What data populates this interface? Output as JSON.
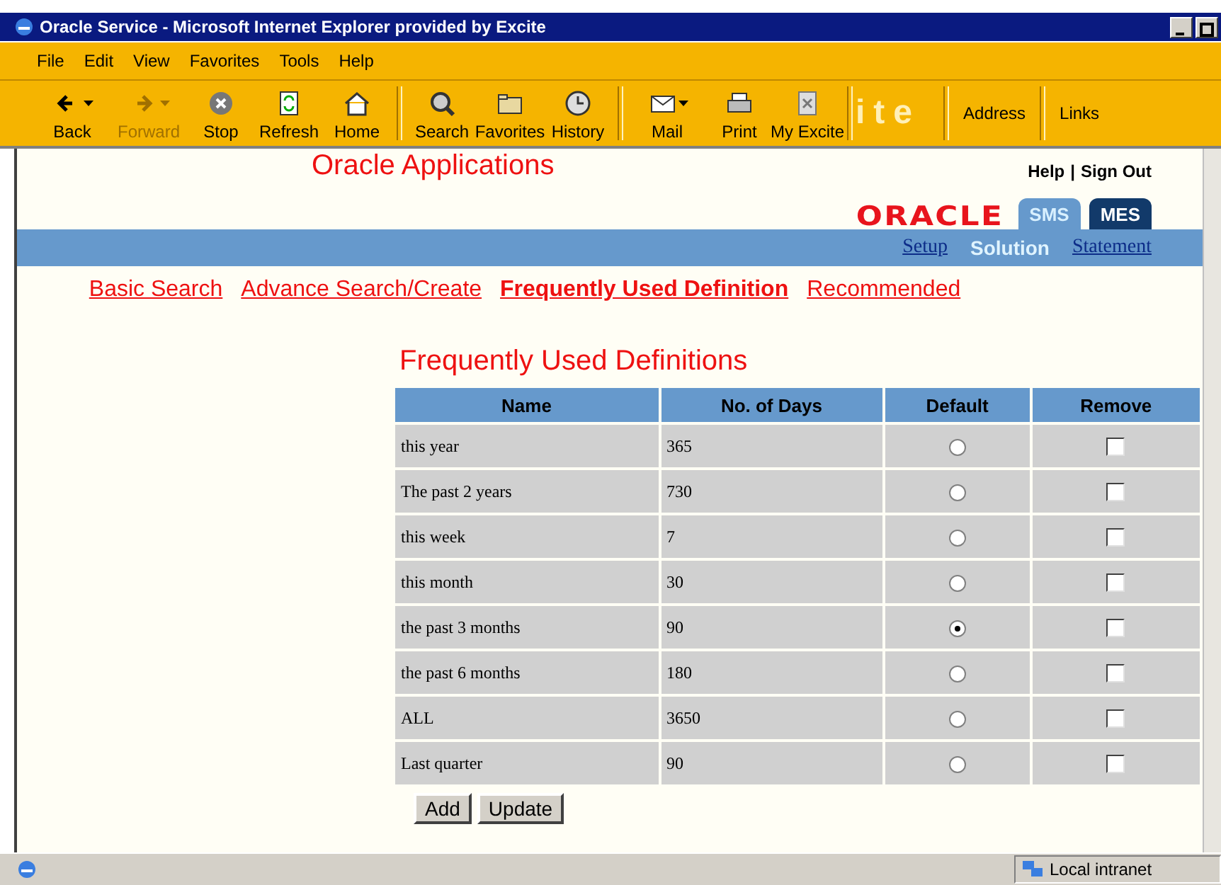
{
  "window": {
    "title": "Oracle Service - Microsoft Internet Explorer provided by Excite"
  },
  "menu": [
    "File",
    "Edit",
    "View",
    "Favorites",
    "Tools",
    "Help"
  ],
  "toolbar": [
    {
      "kind": "back",
      "label": "Back",
      "disabled": false,
      "dropdown": true
    },
    {
      "kind": "forward",
      "label": "Forward",
      "disabled": true,
      "dropdown": true
    },
    {
      "kind": "stop",
      "label": "Stop",
      "disabled": false,
      "dropdown": false
    },
    {
      "kind": "refresh",
      "label": "Refresh",
      "disabled": false,
      "dropdown": false
    },
    {
      "kind": "home",
      "label": "Home",
      "disabled": false,
      "dropdown": false
    },
    {
      "kind": "search",
      "label": "Search",
      "disabled": false,
      "dropdown": false
    },
    {
      "kind": "favorites",
      "label": "Favorites",
      "disabled": false,
      "dropdown": false
    },
    {
      "kind": "history",
      "label": "History",
      "disabled": false,
      "dropdown": false
    },
    {
      "kind": "mail",
      "label": "Mail",
      "disabled": false,
      "dropdown": true
    },
    {
      "kind": "print",
      "label": "Print",
      "disabled": false,
      "dropdown": false
    },
    {
      "kind": "myexcite",
      "label": "My Excite",
      "disabled": false,
      "dropdown": false
    }
  ],
  "brand": "ite",
  "address_label": "Address",
  "links_label": "Links",
  "page": {
    "app_title": "Oracle Applications",
    "top_links": [
      "Help",
      "Sign Out"
    ],
    "top_separator": "|",
    "logo": "ORACLE",
    "tabs": [
      {
        "label": "SMS",
        "selected": true
      },
      {
        "label": "MES",
        "selected": false
      }
    ],
    "subnav": [
      {
        "label": "Setup",
        "selected": false
      },
      {
        "label": "Solution",
        "selected": true
      },
      {
        "label": "Statement",
        "selected": false
      }
    ],
    "search_nav": [
      {
        "label": "Basic Search",
        "selected": false
      },
      {
        "label": "Advance Search/Create",
        "selected": false
      },
      {
        "label": "Frequently Used Definition",
        "selected": true
      },
      {
        "label": "Recommended",
        "selected": false
      }
    ],
    "heading": "Frequently Used Definitions",
    "table": {
      "columns": [
        "Name",
        "No. of Days",
        "Default",
        "Remove"
      ],
      "rows": [
        {
          "name": "this year",
          "days": "365",
          "default": false,
          "remove": false
        },
        {
          "name": "The past 2 years",
          "days": "730",
          "default": false,
          "remove": false
        },
        {
          "name": "this week",
          "days": "7",
          "default": false,
          "remove": false
        },
        {
          "name": "this month",
          "days": "30",
          "default": false,
          "remove": false
        },
        {
          "name": "the past 3 months",
          "days": "90",
          "default": true,
          "remove": false
        },
        {
          "name": "the past 6 months",
          "days": "180",
          "default": false,
          "remove": false
        },
        {
          "name": "ALL",
          "days": "3650",
          "default": false,
          "remove": false
        },
        {
          "name": "Last quarter",
          "days": "90",
          "default": false,
          "remove": false
        }
      ]
    },
    "buttons": [
      "Add",
      "Update"
    ]
  },
  "status_bar": {
    "zone": "Local intranet"
  }
}
